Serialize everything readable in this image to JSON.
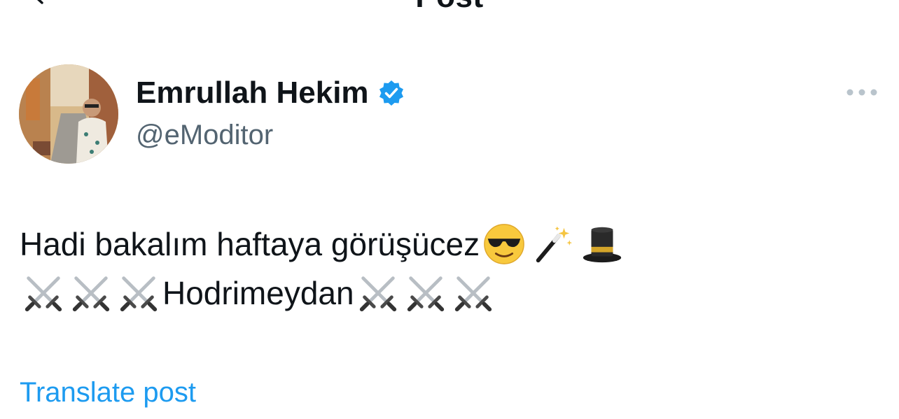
{
  "header": {
    "title": "Post",
    "back_icon": "back-arrow-icon"
  },
  "author": {
    "name": "Emrullah Hekim",
    "handle": "@eModitor",
    "verified": true,
    "verified_color": "#1d9bf0",
    "avatar_icon": "avatar-photo"
  },
  "more_icon": "more-horizontal-icon",
  "post": {
    "line1_text": "Hadi bakalım haftaya görüşücez",
    "line1_emojis": [
      "😎",
      "🪄",
      "🎩"
    ],
    "line2_prefix_emojis": [
      "⚔️",
      "⚔️",
      "⚔️"
    ],
    "line2_text": "Hodrimeydan",
    "line2_suffix_emojis": [
      "⚔️",
      "⚔️",
      "⚔️"
    ]
  },
  "translate_label": "Translate post",
  "colors": {
    "text": "#0f1419",
    "secondary": "#536471",
    "link": "#1d9bf0"
  }
}
